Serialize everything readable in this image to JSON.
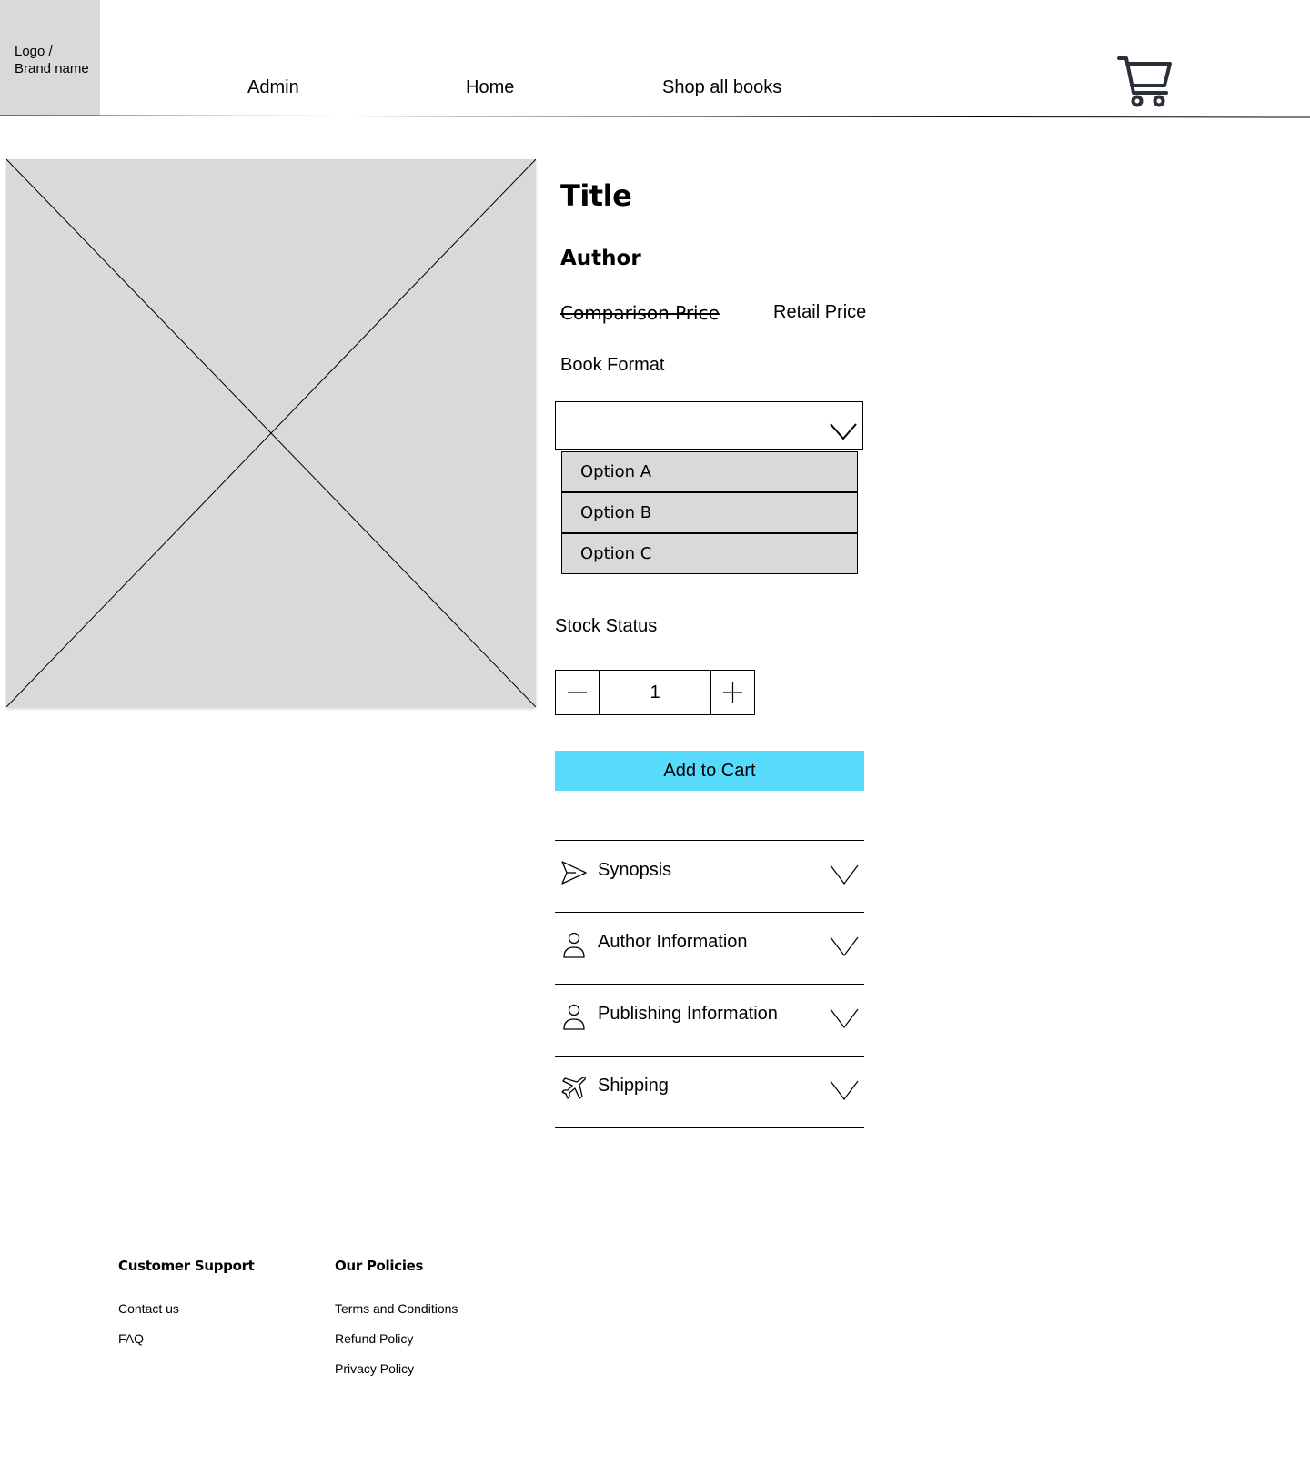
{
  "header": {
    "logo_text": "Logo /\nBrand name",
    "nav": [
      {
        "label": "Admin"
      },
      {
        "label": "Home"
      },
      {
        "label": "Shop all books"
      }
    ],
    "cart_icon": "shopping-cart-icon"
  },
  "product": {
    "image_icon": "image-placeholder-icon",
    "title": "Title",
    "author": "Author",
    "comparison_price": "Comparison Price",
    "retail_price": "Retail Price",
    "format_label": "Book Format",
    "format_select": {
      "selected_value": "",
      "options": [
        "Option A",
        "Option B",
        "Option C"
      ]
    },
    "stock_status": "Stock Status",
    "quantity": "1",
    "add_to_cart_label": "Add to Cart"
  },
  "accordion": [
    {
      "label": "Synopsis",
      "icon": "paper-plane-icon"
    },
    {
      "label": "Author Information",
      "icon": "person-icon"
    },
    {
      "label": "Publishing Information",
      "icon": "person-icon"
    },
    {
      "label": "Shipping",
      "icon": "airplane-icon"
    }
  ],
  "footer": {
    "customer_support": {
      "heading": "Customer Support",
      "links": [
        "Contact us",
        "FAQ"
      ]
    },
    "policies": {
      "heading": "Our Policies",
      "links": [
        "Terms and Conditions",
        "Refund Policy",
        "Privacy Policy"
      ]
    }
  },
  "colors": {
    "placeholder_gray": "#d9d9d9",
    "add_to_cart_blue": "#56dbfc",
    "cart_icon": "#2b2f3a"
  }
}
